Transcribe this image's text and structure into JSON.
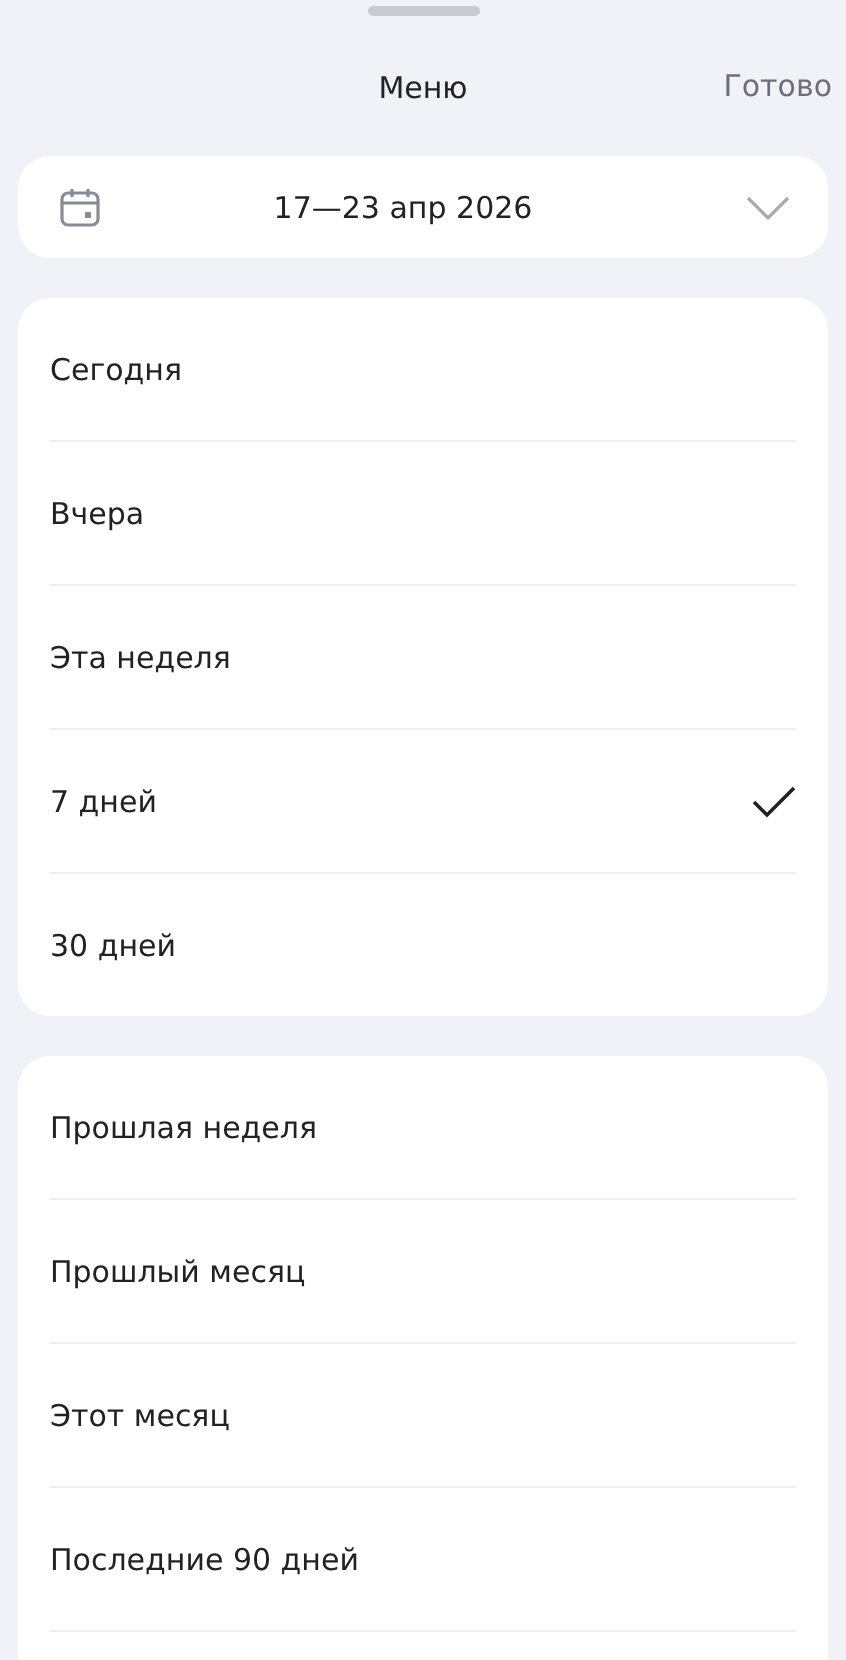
{
  "header": {
    "title": "Меню",
    "done": "Готово"
  },
  "date_range": {
    "label": "17—23 апр 2026"
  },
  "groups": [
    {
      "items": [
        {
          "label": "Сегодня",
          "selected": false
        },
        {
          "label": "Вчера",
          "selected": false
        },
        {
          "label": "Эта неделя",
          "selected": false
        },
        {
          "label": "7 дней",
          "selected": true
        },
        {
          "label": "30 дней",
          "selected": false
        }
      ]
    },
    {
      "items": [
        {
          "label": "Прошлая неделя",
          "selected": false
        },
        {
          "label": "Прошлый месяц",
          "selected": false
        },
        {
          "label": "Этот месяц",
          "selected": false
        },
        {
          "label": "Последние 90 дней",
          "selected": false
        }
      ]
    }
  ]
}
